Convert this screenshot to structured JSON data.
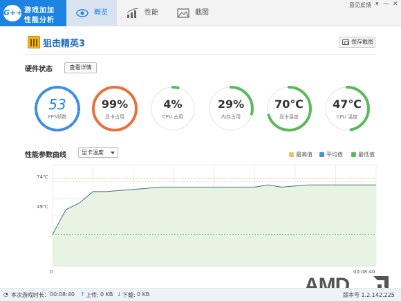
{
  "app": {
    "logo_line1": "游戏加加",
    "logo_line2": "性能分析",
    "logo_badge": "G++"
  },
  "tabs": [
    {
      "label": "概览",
      "icon": "eye-icon",
      "active": true
    },
    {
      "label": "性能",
      "icon": "chart-icon",
      "active": false
    },
    {
      "label": "截图",
      "icon": "image-icon",
      "active": false
    }
  ],
  "window": {
    "feedback": "意见反馈",
    "menu": "▾",
    "minimize": "—",
    "close": "✕"
  },
  "game": {
    "name": "狙击精英3"
  },
  "save_button": "保存截图",
  "hardware": {
    "title": "硬件状态",
    "detail_button": "查看详情",
    "gauges": [
      {
        "value": "53",
        "label": "FPS帧数",
        "fraction": 1.0,
        "color": "#3a8ee6"
      },
      {
        "value": "99%",
        "label": "显卡占用",
        "fraction": 0.99,
        "color": "#e8703a"
      },
      {
        "value": "4%",
        "label": "CPU 占用",
        "fraction": 0.04,
        "color": "#5cb85c"
      },
      {
        "value": "29%",
        "label": "内存占用",
        "fraction": 0.29,
        "color": "#5cb85c"
      },
      {
        "value": "70℃",
        "label": "显卡温度",
        "fraction": 0.7,
        "color": "#5cb85c"
      },
      {
        "value": "47℃",
        "label": "CPU 温度",
        "fraction": 0.47,
        "color": "#5cb85c"
      }
    ]
  },
  "curve": {
    "title": "性能参数曲线",
    "selected": "显卡温度",
    "legend": [
      {
        "label": "最高值",
        "color": "#e8c36a"
      },
      {
        "label": "平均值",
        "color": "#4a90d9"
      },
      {
        "label": "最低值",
        "color": "#5cb85c"
      }
    ]
  },
  "chart_data": {
    "type": "area",
    "ylabel": "",
    "xlabel": "",
    "x_ticks": [
      "0",
      "00:08:40"
    ],
    "y_ticks": [
      "74℃",
      "49℃"
    ],
    "ylim": [
      35,
      80
    ],
    "grid": true,
    "series": [
      {
        "values": [
          49,
          60,
          63,
          68,
          68,
          68.5,
          69,
          69.5,
          70,
          70,
          70,
          70,
          70,
          70,
          70,
          70,
          71,
          70,
          70.5,
          71,
          71,
          71,
          71,
          71,
          71
        ]
      }
    ],
    "max_line": 74,
    "min_line": 49
  },
  "status": {
    "duration_label": "本次游戏时长：",
    "duration": "00:08:40",
    "upload_label": "上传:",
    "upload": "0 KB",
    "download_label": "下载:",
    "download": "0 KB",
    "version": "版本号 1.2.142.225"
  },
  "watermark": "AMD"
}
